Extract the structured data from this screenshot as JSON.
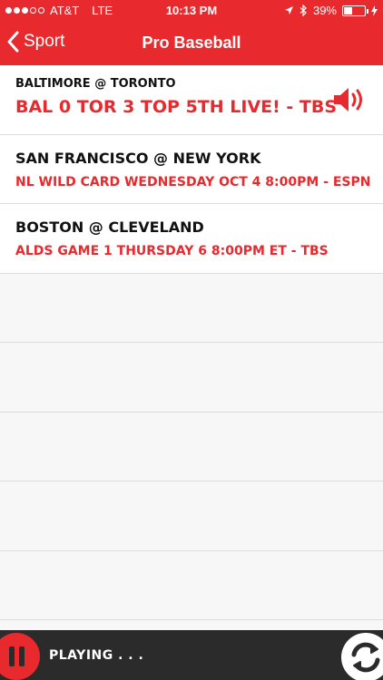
{
  "status_bar": {
    "carrier": "AT&T",
    "network": "LTE",
    "time": "10:13 PM",
    "battery": "39%",
    "battery_level": 0.39,
    "signal_bars_filled": 3,
    "signal_bars_total": 5
  },
  "nav": {
    "back_label": "Sport",
    "title": "Pro Baseball"
  },
  "games": [
    {
      "matchup": "BALTIMORE @ TORONTO",
      "status": "BAL 0 TOR 3 TOP 5TH LIVE! - TBS",
      "live": true
    },
    {
      "matchup": "SAN FRANCISCO @ NEW YORK",
      "status": "NL WILD CARD WEDNESDAY OCT 4 8:00PM - ESPN",
      "live": false
    },
    {
      "matchup": "BOSTON @ CLEVELAND",
      "status": "ALDS GAME 1 THURSDAY 6 8:00PM ET - TBS",
      "live": false
    }
  ],
  "player": {
    "label": "PLAYING . . ."
  },
  "colors": {
    "accent": "#e8292d",
    "player_bg": "#2b2b2b"
  },
  "icons": {
    "back": "chevron-left-icon",
    "speaker": "speaker-icon",
    "pause": "pause-icon",
    "refresh": "refresh-icon",
    "location": "location-arrow-icon",
    "bluetooth": "bluetooth-icon",
    "battery": "battery-icon",
    "charging": "charging-bolt-icon"
  }
}
